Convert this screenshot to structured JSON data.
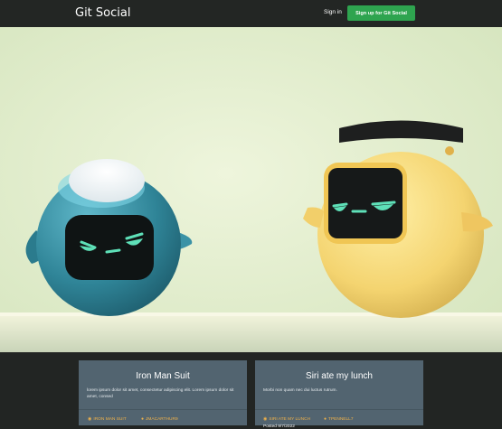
{
  "nav": {
    "brand": "Git Social",
    "signin": "Sign in",
    "signup": "Sign up for Git Social"
  },
  "cards": [
    {
      "title": "Iron Man Suit",
      "description": "lorem ipsum dolor sit amet, consectetur adipiscing elit. Lorem ipsum dolor sit amet, consed",
      "repo": "IRON MAN SUIT",
      "user": "JMACARTHUR9",
      "posted": ""
    },
    {
      "title": "Siri ate my lunch",
      "description": "Morbi non quam nec dui luctus rutrum.",
      "repo": "SIRI ATE MY LUNCH",
      "user": "TPENNELL7",
      "posted": "Posted 9/7/2022"
    }
  ],
  "colors": {
    "accent": "#2ea44f",
    "card_bg": "#526470",
    "meta": "#f0b24a"
  }
}
